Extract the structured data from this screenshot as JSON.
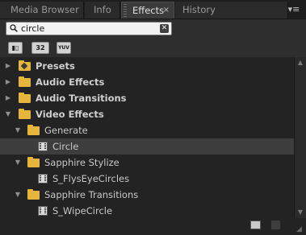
{
  "tabs": [
    {
      "label": "Media Browser"
    },
    {
      "label": "Info"
    },
    {
      "label": "Effects",
      "active": true
    },
    {
      "label": "History"
    }
  ],
  "tab_close_glyph": "×",
  "panel_menu_glyph": "▾≡",
  "search": {
    "value": "circle",
    "placeholder": ""
  },
  "filters": [
    {
      "label": "▮▯",
      "icon": "accelerated-effects-icon"
    },
    {
      "label": "32",
      "icon": "32-bit-effects-icon"
    },
    {
      "label": "YUV",
      "icon": "yuv-effects-icon"
    }
  ],
  "tree": [
    {
      "label": "Presets",
      "depth": 0,
      "expanded": false,
      "kind": "folder-special",
      "bold": true
    },
    {
      "label": "Audio Effects",
      "depth": 0,
      "expanded": false,
      "kind": "folder",
      "bold": true
    },
    {
      "label": "Audio Transitions",
      "depth": 0,
      "expanded": false,
      "kind": "folder",
      "bold": true
    },
    {
      "label": "Video Effects",
      "depth": 0,
      "expanded": true,
      "kind": "folder",
      "bold": true
    },
    {
      "label": "Generate",
      "depth": 1,
      "expanded": true,
      "kind": "folder",
      "bold": false
    },
    {
      "label": "Circle",
      "depth": 2,
      "kind": "effect",
      "bold": false,
      "selected": true
    },
    {
      "label": "Sapphire Stylize",
      "depth": 1,
      "expanded": true,
      "kind": "folder",
      "bold": false
    },
    {
      "label": "S_FlysEyeCircles",
      "depth": 2,
      "kind": "effect",
      "bold": false
    },
    {
      "label": "Sapphire Transitions",
      "depth": 1,
      "expanded": true,
      "kind": "folder",
      "bold": false
    },
    {
      "label": "S_WipeCircle",
      "depth": 2,
      "kind": "effect",
      "bold": false
    }
  ],
  "colors": {
    "panel_bg": "#232323",
    "folder": "#e7b53c",
    "selection": "#3d3d3d",
    "text": "#c8c8c8"
  }
}
